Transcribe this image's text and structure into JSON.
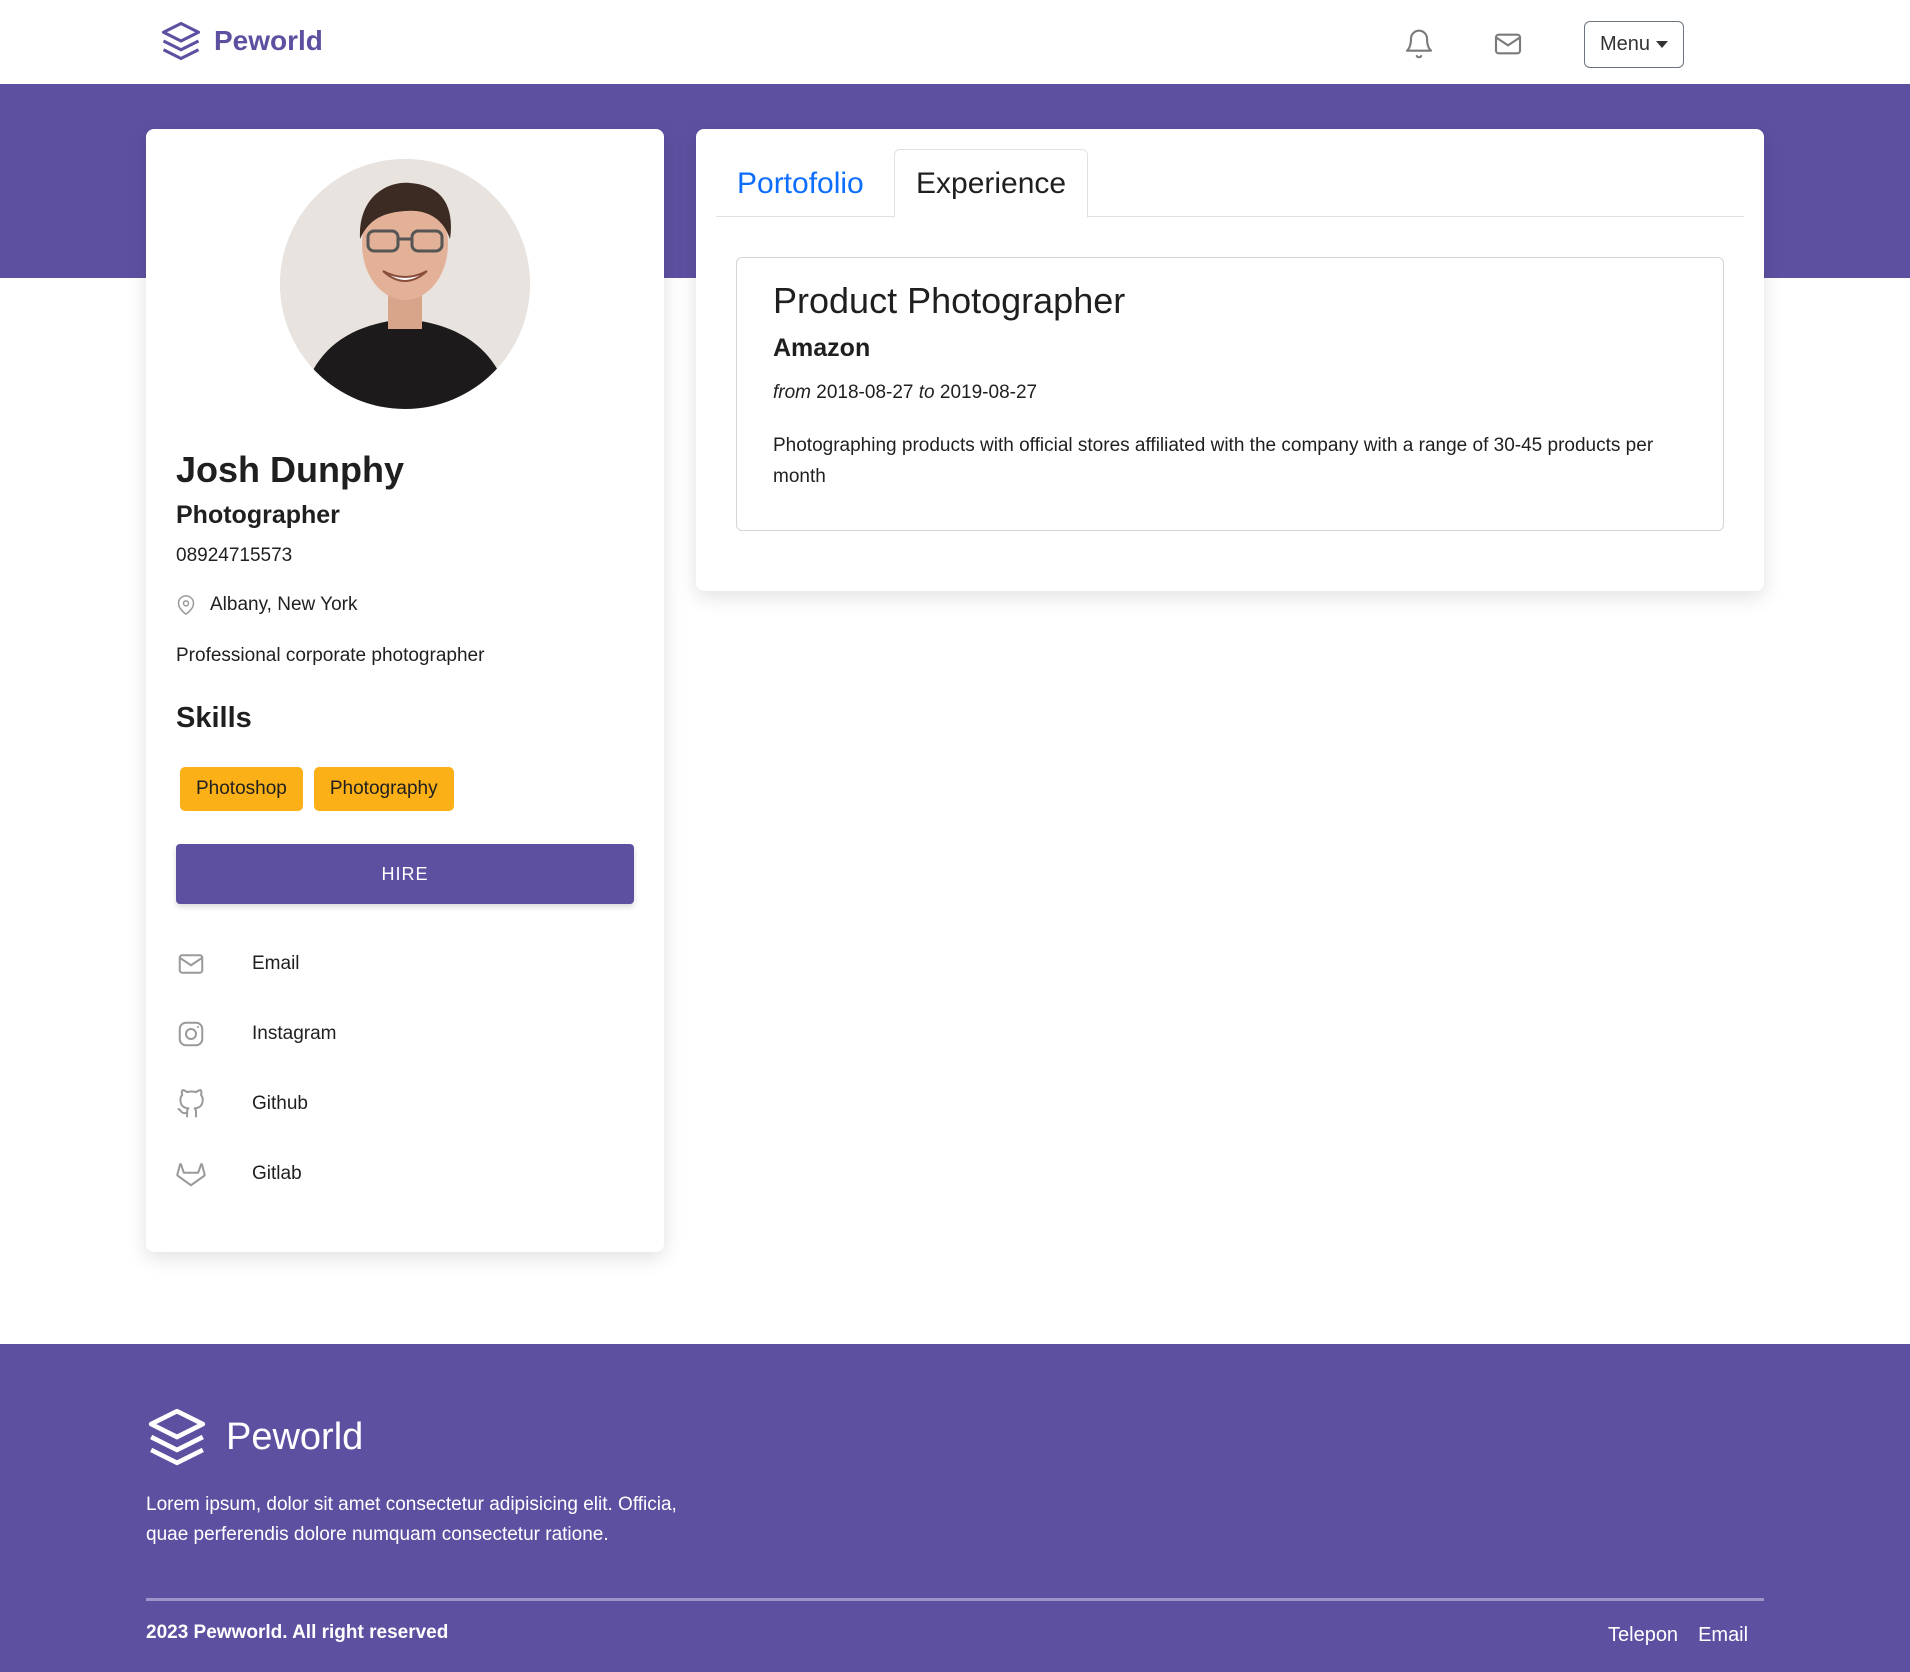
{
  "navbar": {
    "brand": "Peworld",
    "menu_label": "Menu",
    "notification_icon": "bell-icon",
    "message_icon": "mail-icon"
  },
  "profile": {
    "name": "Josh Dunphy",
    "role": "Photographer",
    "phone": "08924715573",
    "location": "Albany, New York",
    "description": "Professional corporate photographer",
    "skills_heading": "Skills",
    "skills": [
      "Photoshop",
      "Photography"
    ],
    "hire_label": "HIRE",
    "links": [
      {
        "label": "Email",
        "icon": "mail-icon"
      },
      {
        "label": "Instagram",
        "icon": "instagram-icon"
      },
      {
        "label": "Github",
        "icon": "github-icon"
      },
      {
        "label": "Gitlab",
        "icon": "gitlab-icon"
      }
    ]
  },
  "tabs": [
    {
      "label": "Portofolio",
      "active": false
    },
    {
      "label": "Experience",
      "active": true
    }
  ],
  "experience": {
    "title": "Product Photographer",
    "company": "Amazon",
    "from_word": "from",
    "start": "2018-08-27",
    "to_word": "to",
    "end": "2019-08-27",
    "description": "Photographing products with official stores affiliated with the company with a range of 30-45 products per month"
  },
  "footer": {
    "brand": "Peworld",
    "description": "Lorem ipsum, dolor sit amet consectetur adipisicing elit. Officia, quae perferendis dolore numquam consectetur ratione.",
    "copyright": "2023 Pewworld. All right reserved",
    "links": [
      "Telepon",
      "Email"
    ]
  },
  "colors": {
    "brand": "#5e50a1",
    "skill_badge": "#fbb017",
    "active_tab_link": "#0d6efd"
  }
}
